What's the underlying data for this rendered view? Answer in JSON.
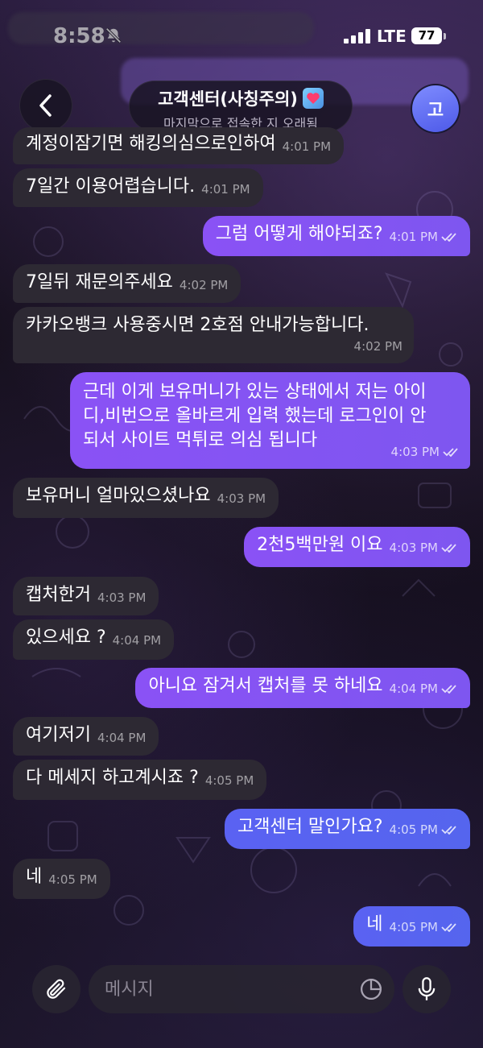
{
  "status_bar": {
    "time": "8:58",
    "network": "LTE",
    "battery": "77"
  },
  "header": {
    "title": "고객센터(사칭주의)",
    "subtitle": "마지막으로 접속한 지 오래됨",
    "avatar_initial": "고",
    "back_icon": "chevron-left-icon",
    "badge_icon": "heart-icon"
  },
  "messages": [
    {
      "side": "in",
      "text": "계정이잠기면 해킹의심으로인하여",
      "time": "4:01 PM"
    },
    {
      "side": "in",
      "text": "7일간 이용어렵습니다.",
      "time": "4:01 PM"
    },
    {
      "side": "out",
      "text": "그럼 어떻게 해야되죠?",
      "time": "4:01 PM"
    },
    {
      "side": "in",
      "text": "7일뒤 재문의주세요",
      "time": "4:02 PM"
    },
    {
      "side": "in",
      "text": "카카오뱅크 사용중시면 2호점 안내가능합니다.",
      "time": "4:02 PM"
    },
    {
      "side": "out",
      "lines": [
        "근데 이게 보유머니가 있는 상태에서 저는 아이",
        "디,비번으로 올바르게 입력 했는데 로그인이 안",
        "되서 사이트 먹튀로 의심 됩니다"
      ],
      "time": "4:03 PM"
    },
    {
      "side": "in",
      "text": "보유머니 얼마있으셨나요",
      "time": "4:03 PM"
    },
    {
      "side": "out",
      "text": "2천5백만원 이요",
      "time": "4:03 PM"
    },
    {
      "side": "in",
      "text": "캡처한거",
      "time": "4:03 PM"
    },
    {
      "side": "in",
      "text": "있으세요 ?",
      "time": "4:04 PM"
    },
    {
      "side": "out",
      "text": "아니요 잠겨서 캡처를 못 하네요",
      "time": "4:04 PM"
    },
    {
      "side": "in",
      "text": "여기저기",
      "time": "4:04 PM"
    },
    {
      "side": "in",
      "text": "다 메세지 하고계시죠 ?",
      "time": "4:05 PM"
    },
    {
      "side": "out",
      "text": "고객센터 말인가요?",
      "time": "4:05 PM"
    },
    {
      "side": "in",
      "text": "네",
      "time": "4:05 PM"
    },
    {
      "side": "out",
      "text": "네",
      "time": "4:05 PM"
    }
  ],
  "composer": {
    "placeholder": "메시지",
    "attach_icon": "paperclip-icon",
    "sticker_icon": "sticker-icon",
    "mic_icon": "microphone-icon"
  },
  "colors": {
    "outgoing_bubble": "#8a52f5",
    "outgoing_bubble_late": "#5a62f2",
    "incoming_bubble": "#2d2933",
    "avatar": "#5b63ee"
  }
}
